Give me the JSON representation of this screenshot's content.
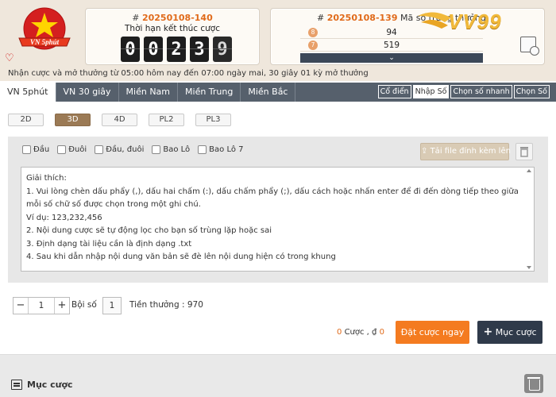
{
  "logo": {
    "text": "VN 5phút"
  },
  "countdown": {
    "ticket_prefix": "#",
    "ticket_id": "20250108-140",
    "title": "Thời hạn kết thúc cược",
    "digits": [
      "0",
      "0",
      "2",
      "3",
      "9"
    ]
  },
  "results": {
    "ticket_prefix": "#",
    "ticket_id": "20250108-139",
    "label": "Mã số trúng thưởng",
    "rows": [
      {
        "badge": "8",
        "value": "94"
      },
      {
        "badge": "7",
        "value": "519"
      }
    ],
    "expand_icon": "chevron-down-icon"
  },
  "brand": {
    "text": "VV99"
  },
  "notice": "Nhận cược và mở thưởng từ 05:00 hôm nay đến 07:00 ngày mai,   30 giây 01 kỳ mở thưởng",
  "tabs": [
    {
      "label": "VN 5phút",
      "active": true
    },
    {
      "label": "VN 30 giây",
      "active": false
    },
    {
      "label": "Miền Nam",
      "active": false
    },
    {
      "label": "Miền Trung",
      "active": false
    },
    {
      "label": "Miền Bắc",
      "active": false
    }
  ],
  "modes": [
    {
      "label": "Cổ điển",
      "active": false
    },
    {
      "label": "Nhập Số",
      "active": true
    },
    {
      "label": "Chọn số nhanh",
      "active": false
    },
    {
      "label": "Chọn Số",
      "active": false
    }
  ],
  "types": [
    {
      "label": "2D",
      "active": false
    },
    {
      "label": "3D",
      "active": true
    },
    {
      "label": "4D",
      "active": false
    },
    {
      "label": "PL2",
      "active": false
    },
    {
      "label": "PL3",
      "active": false
    }
  ],
  "checkboxes": [
    "Đầu",
    "Đuôi",
    "Đầu, đuôi",
    "Bao Lô",
    "Bao Lô 7"
  ],
  "upload_label": "Tải file đính kèm lên",
  "instructions": [
    "Giải thích:",
    "1. Vui lòng chèn dấu phẩy (,), dấu hai chấm (:), dấu chấm phẩy (;), dấu cách hoặc nhấn enter để đi đến dòng tiếp theo giữa mỗi số chữ số được chọn trong một ghi chú.",
    "Ví dụ: 123,232,456",
    "2. Nội dung cược sẽ tự động lọc cho bạn số trùng lặp hoặc sai",
    "3. Định dạng tài liệu cần là định dạng .txt",
    "4. Sau khi dẫn nhập nội dung văn bản sẽ đè lên nội dung hiện có trong khung"
  ],
  "stepper": {
    "minus": "−",
    "value": "1",
    "plus": "+"
  },
  "multiplier": {
    "label": "Bội số",
    "value": "1"
  },
  "prize": "Tiền thưởng : 970",
  "summary": {
    "count": "0",
    "count_label": "Cược ,",
    "currency": "₫",
    "amount": "0"
  },
  "buttons": {
    "place": "Đặt cược ngay",
    "add": "Mục cược",
    "add_icon": "+"
  },
  "footer": {
    "title": "Mục cược"
  },
  "colors": {
    "accent": "#f47b20",
    "dark": "#2f3a4a",
    "tabbar": "#56606c",
    "ticket": "#e06a1a"
  }
}
